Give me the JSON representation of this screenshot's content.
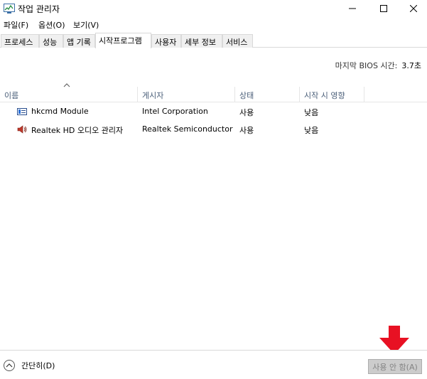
{
  "window": {
    "title": "작업 관리자",
    "icons": {
      "app": "task-manager-icon",
      "minimize": "minimize-icon",
      "maximize": "maximize-icon",
      "close": "close-icon"
    }
  },
  "menu": [
    "파일(F)",
    "옵션(O)",
    "보기(V)"
  ],
  "tabs": [
    "프로세스",
    "성능",
    "앱 기록",
    "시작프로그램",
    "사용자",
    "세부 정보",
    "서비스"
  ],
  "active_tab": "시작프로그램",
  "bios": {
    "label": "마지막 BIOS 시간:",
    "value": "3.7초"
  },
  "columns": [
    "이름",
    "게시자",
    "상태",
    "시작 시 영향"
  ],
  "rows": [
    {
      "icon": "hkcmd-module-icon",
      "name": "hkcmd Module",
      "publisher": "Intel Corporation",
      "status": "사용",
      "impact": "낮음"
    },
    {
      "icon": "speaker-icon",
      "name": "Realtek HD 오디오 관리자",
      "publisher": "Realtek Semiconductor",
      "status": "사용",
      "impact": "낮음"
    }
  ],
  "footer": {
    "collapse_label": "간단히(D)",
    "disable_label": "사용 안 함(A)"
  },
  "colors": {
    "annotation_arrow": "#e81123",
    "header_text": "#4c607a",
    "disabled_button": "#cccccc"
  }
}
